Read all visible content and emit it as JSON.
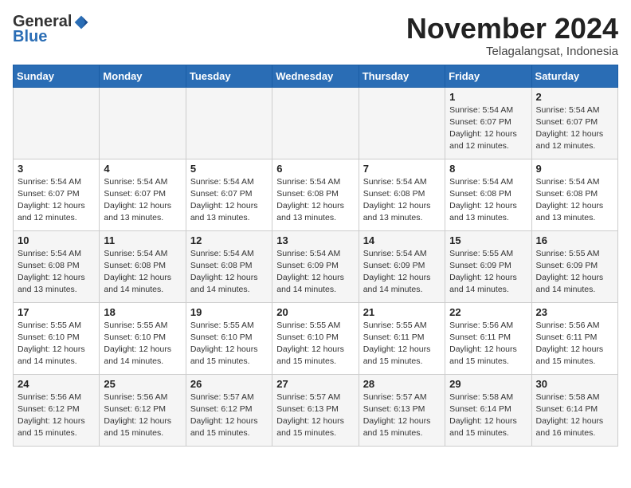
{
  "header": {
    "logo_general": "General",
    "logo_blue": "Blue",
    "title": "November 2024",
    "subtitle": "Telagalangsat, Indonesia"
  },
  "weekdays": [
    "Sunday",
    "Monday",
    "Tuesday",
    "Wednesday",
    "Thursday",
    "Friday",
    "Saturday"
  ],
  "weeks": [
    [
      {
        "day": "",
        "info": ""
      },
      {
        "day": "",
        "info": ""
      },
      {
        "day": "",
        "info": ""
      },
      {
        "day": "",
        "info": ""
      },
      {
        "day": "",
        "info": ""
      },
      {
        "day": "1",
        "info": "Sunrise: 5:54 AM\nSunset: 6:07 PM\nDaylight: 12 hours and 12 minutes."
      },
      {
        "day": "2",
        "info": "Sunrise: 5:54 AM\nSunset: 6:07 PM\nDaylight: 12 hours and 12 minutes."
      }
    ],
    [
      {
        "day": "3",
        "info": "Sunrise: 5:54 AM\nSunset: 6:07 PM\nDaylight: 12 hours and 12 minutes."
      },
      {
        "day": "4",
        "info": "Sunrise: 5:54 AM\nSunset: 6:07 PM\nDaylight: 12 hours and 13 minutes."
      },
      {
        "day": "5",
        "info": "Sunrise: 5:54 AM\nSunset: 6:07 PM\nDaylight: 12 hours and 13 minutes."
      },
      {
        "day": "6",
        "info": "Sunrise: 5:54 AM\nSunset: 6:08 PM\nDaylight: 12 hours and 13 minutes."
      },
      {
        "day": "7",
        "info": "Sunrise: 5:54 AM\nSunset: 6:08 PM\nDaylight: 12 hours and 13 minutes."
      },
      {
        "day": "8",
        "info": "Sunrise: 5:54 AM\nSunset: 6:08 PM\nDaylight: 12 hours and 13 minutes."
      },
      {
        "day": "9",
        "info": "Sunrise: 5:54 AM\nSunset: 6:08 PM\nDaylight: 12 hours and 13 minutes."
      }
    ],
    [
      {
        "day": "10",
        "info": "Sunrise: 5:54 AM\nSunset: 6:08 PM\nDaylight: 12 hours and 13 minutes."
      },
      {
        "day": "11",
        "info": "Sunrise: 5:54 AM\nSunset: 6:08 PM\nDaylight: 12 hours and 14 minutes."
      },
      {
        "day": "12",
        "info": "Sunrise: 5:54 AM\nSunset: 6:08 PM\nDaylight: 12 hours and 14 minutes."
      },
      {
        "day": "13",
        "info": "Sunrise: 5:54 AM\nSunset: 6:09 PM\nDaylight: 12 hours and 14 minutes."
      },
      {
        "day": "14",
        "info": "Sunrise: 5:54 AM\nSunset: 6:09 PM\nDaylight: 12 hours and 14 minutes."
      },
      {
        "day": "15",
        "info": "Sunrise: 5:55 AM\nSunset: 6:09 PM\nDaylight: 12 hours and 14 minutes."
      },
      {
        "day": "16",
        "info": "Sunrise: 5:55 AM\nSunset: 6:09 PM\nDaylight: 12 hours and 14 minutes."
      }
    ],
    [
      {
        "day": "17",
        "info": "Sunrise: 5:55 AM\nSunset: 6:10 PM\nDaylight: 12 hours and 14 minutes."
      },
      {
        "day": "18",
        "info": "Sunrise: 5:55 AM\nSunset: 6:10 PM\nDaylight: 12 hours and 14 minutes."
      },
      {
        "day": "19",
        "info": "Sunrise: 5:55 AM\nSunset: 6:10 PM\nDaylight: 12 hours and 15 minutes."
      },
      {
        "day": "20",
        "info": "Sunrise: 5:55 AM\nSunset: 6:10 PM\nDaylight: 12 hours and 15 minutes."
      },
      {
        "day": "21",
        "info": "Sunrise: 5:55 AM\nSunset: 6:11 PM\nDaylight: 12 hours and 15 minutes."
      },
      {
        "day": "22",
        "info": "Sunrise: 5:56 AM\nSunset: 6:11 PM\nDaylight: 12 hours and 15 minutes."
      },
      {
        "day": "23",
        "info": "Sunrise: 5:56 AM\nSunset: 6:11 PM\nDaylight: 12 hours and 15 minutes."
      }
    ],
    [
      {
        "day": "24",
        "info": "Sunrise: 5:56 AM\nSunset: 6:12 PM\nDaylight: 12 hours and 15 minutes."
      },
      {
        "day": "25",
        "info": "Sunrise: 5:56 AM\nSunset: 6:12 PM\nDaylight: 12 hours and 15 minutes."
      },
      {
        "day": "26",
        "info": "Sunrise: 5:57 AM\nSunset: 6:12 PM\nDaylight: 12 hours and 15 minutes."
      },
      {
        "day": "27",
        "info": "Sunrise: 5:57 AM\nSunset: 6:13 PM\nDaylight: 12 hours and 15 minutes."
      },
      {
        "day": "28",
        "info": "Sunrise: 5:57 AM\nSunset: 6:13 PM\nDaylight: 12 hours and 15 minutes."
      },
      {
        "day": "29",
        "info": "Sunrise: 5:58 AM\nSunset: 6:14 PM\nDaylight: 12 hours and 15 minutes."
      },
      {
        "day": "30",
        "info": "Sunrise: 5:58 AM\nSunset: 6:14 PM\nDaylight: 12 hours and 16 minutes."
      }
    ]
  ]
}
